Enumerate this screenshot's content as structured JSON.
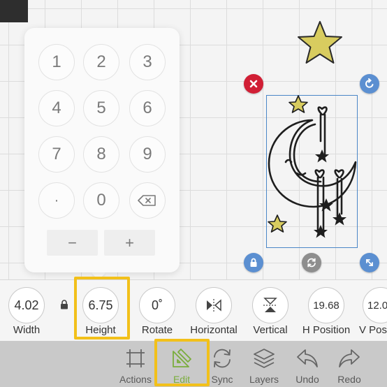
{
  "canvas": {
    "selection_color": "#4a86c7",
    "handles": {
      "delete": {
        "icon": "close-icon",
        "color": "#d11f35"
      },
      "rotate": {
        "icon": "rotate-icon",
        "color": "#5b8fd1"
      },
      "lock": {
        "icon": "lock-icon",
        "color": "#5b8fd1"
      },
      "sync": {
        "icon": "sync-icon",
        "color": "#8e8e8e"
      },
      "scale": {
        "icon": "resize-icon",
        "color": "#5b8fd1"
      }
    },
    "star_color": "#d8cc5f"
  },
  "keypad": {
    "keys": [
      "1",
      "2",
      "3",
      "4",
      "5",
      "6",
      "7",
      "8",
      "9",
      "·",
      "0"
    ],
    "backspace_icon": "backspace-icon",
    "minus": "−",
    "plus": "+"
  },
  "properties": {
    "width": {
      "value": "4.02",
      "label": "Width"
    },
    "height": {
      "value": "6.75",
      "label": "Height"
    },
    "rotate": {
      "value": "0˚",
      "label": "Rotate"
    },
    "horizontal": {
      "icon": "flip-horizontal-icon",
      "label": "Horizontal"
    },
    "vertical": {
      "icon": "flip-vertical-icon",
      "label": "Vertical"
    },
    "h_position": {
      "value": "19.68",
      "label": "H Position"
    },
    "v_position": {
      "value": "12.0",
      "label": "V Posi"
    }
  },
  "toolbar": {
    "items": [
      {
        "label": "Actions",
        "icon": "actions-icon"
      },
      {
        "label": "Edit",
        "icon": "edit-icon"
      },
      {
        "label": "Sync",
        "icon": "sync-icon"
      },
      {
        "label": "Layers",
        "icon": "layers-icon"
      },
      {
        "label": "Undo",
        "icon": "undo-icon"
      },
      {
        "label": "Redo",
        "icon": "redo-icon"
      }
    ],
    "active_color": "#7aad3c",
    "highlight_color": "#f2c01a"
  }
}
